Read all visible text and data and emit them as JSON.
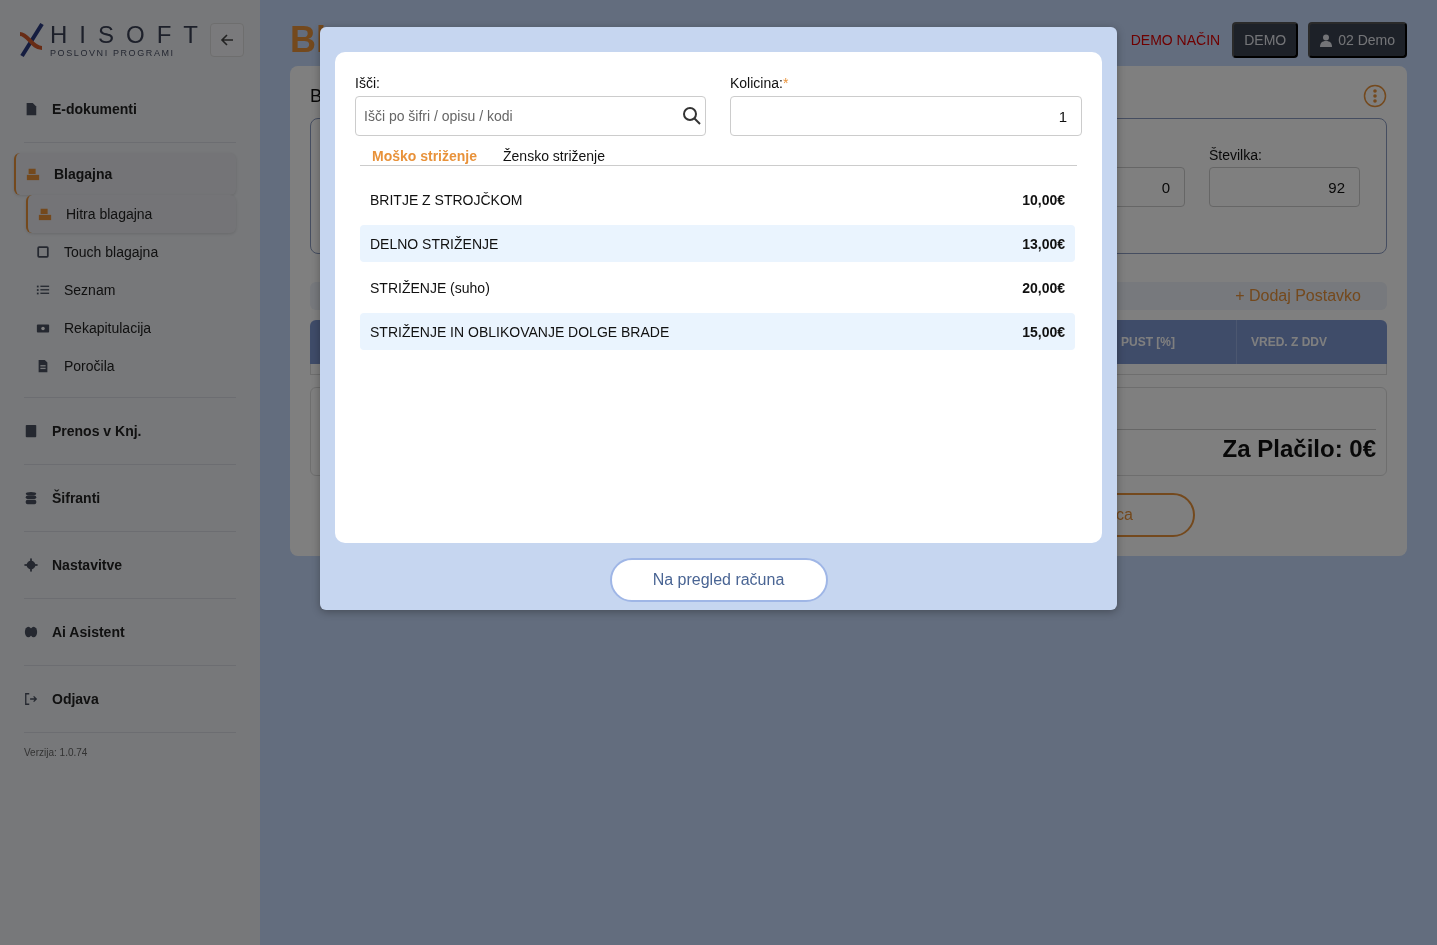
{
  "sidebar": {
    "logo": {
      "name": "HISOFT",
      "tagline": "POSLOVNI PROGRAMI"
    },
    "items": [
      {
        "label": "E-dokumenti",
        "selected": false
      },
      {
        "label": "Blagajna",
        "selected": true,
        "children": [
          {
            "label": "Hitra blagajna",
            "selected": true
          },
          {
            "label": "Touch blagajna",
            "selected": false
          },
          {
            "label": "Seznam",
            "selected": false
          },
          {
            "label": "Rekapitulacija",
            "selected": false
          },
          {
            "label": "Poročila",
            "selected": false
          }
        ]
      },
      {
        "label": "Prenos v Knj.",
        "selected": false
      },
      {
        "label": "Šifranti",
        "selected": false
      },
      {
        "label": "Nastavitve",
        "selected": false
      },
      {
        "label": "Ai Asistent",
        "selected": false
      },
      {
        "label": "Odjava",
        "selected": false
      }
    ],
    "version": "Verzija: 1.0.74"
  },
  "header": {
    "title": "Bl",
    "mode": "DEMO NAČIN",
    "badge": "DEMO",
    "user": "02 Demo"
  },
  "background_card": {
    "heading": "B",
    "fields": [
      {
        "value": "0"
      },
      {
        "label": "Številka:",
        "value": "92"
      }
    ],
    "add_button": "+ Dodaj Postavko",
    "columns": [
      "PUST [%]",
      "VRED. Z DDV"
    ],
    "total": "Za Plačilo: 0€",
    "action_button": "ca"
  },
  "modal": {
    "search": {
      "label": "Išči:",
      "placeholder": "Išči po šifri / opisu / kodi"
    },
    "quantity": {
      "label": "Kolicina:",
      "required_mark": "*",
      "value": "1"
    },
    "tabs": [
      {
        "label": "Moško striženje",
        "selected": true
      },
      {
        "label": "Žensko striženje",
        "selected": false
      }
    ],
    "items": [
      {
        "name": "BRITJE Z STROJČKOM",
        "price": "10,00€"
      },
      {
        "name": "DELNO STRIŽENJE",
        "price": "13,00€"
      },
      {
        "name": "STRIŽENJE (suho)",
        "price": "20,00€"
      },
      {
        "name": "STRIŽENJE IN OBLIKOVANJE DOLGE BRADE",
        "price": "15,00€"
      }
    ],
    "button": "Na pregled računa"
  }
}
